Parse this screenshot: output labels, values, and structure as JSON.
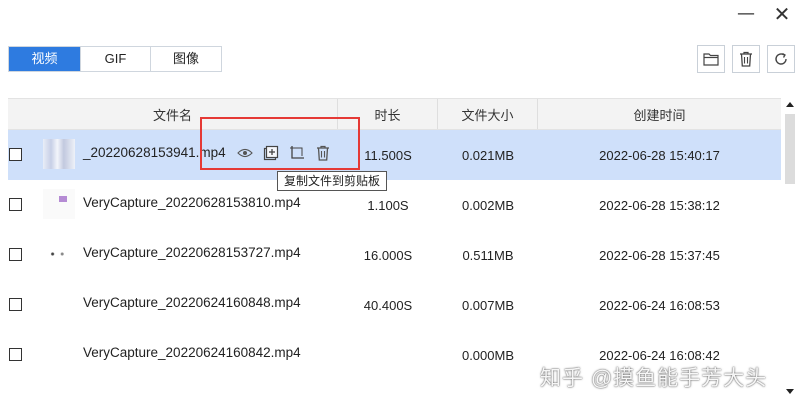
{
  "window": {
    "minimize_icon": "minimize-icon",
    "close_icon": "close-icon",
    "minimize_glyph": "—",
    "close_glyph": "✕"
  },
  "tabs": [
    {
      "label": "视频",
      "active": true
    },
    {
      "label": "GIF",
      "active": false
    },
    {
      "label": "图像",
      "active": false
    }
  ],
  "toolbar": {
    "buttons": [
      "folder-icon",
      "trash-icon",
      "refresh-icon"
    ]
  },
  "table": {
    "headers": {
      "name": "文件名",
      "duration": "时长",
      "size": "文件大小",
      "created": "创建时间"
    },
    "rows": [
      {
        "name": "_20220628153941.mp4",
        "duration": "11.500S",
        "size": "0.021MB",
        "created": "2022-06-28 15:40:17",
        "selected": true
      },
      {
        "name": "VeryCapture_20220628153810.mp4",
        "duration": "1.100S",
        "size": "0.002MB",
        "created": "2022-06-28 15:38:12",
        "selected": false
      },
      {
        "name": "VeryCapture_20220628153727.mp4",
        "duration": "16.000S",
        "size": "0.511MB",
        "created": "2022-06-28 15:37:45",
        "selected": false
      },
      {
        "name": "VeryCapture_20220624160848.mp4",
        "duration": "40.400S",
        "size": "0.007MB",
        "created": "2022-06-24 16:08:53",
        "selected": false
      },
      {
        "name": "VeryCapture_20220624160842.mp4",
        "duration": "",
        "size": "0.000MB",
        "created": "2022-06-24 16:08:42",
        "selected": false
      }
    ]
  },
  "row_actions": [
    "eye-icon",
    "copy-to-clipboard-icon",
    "crop-icon",
    "delete-icon"
  ],
  "tooltip": "复制文件到剪贴板",
  "watermark": "知乎 @摸鱼能手芳大头",
  "colors": {
    "accent": "#2e7be0",
    "selected_row": "#cfe0fa",
    "highlight_box": "#e53935"
  }
}
